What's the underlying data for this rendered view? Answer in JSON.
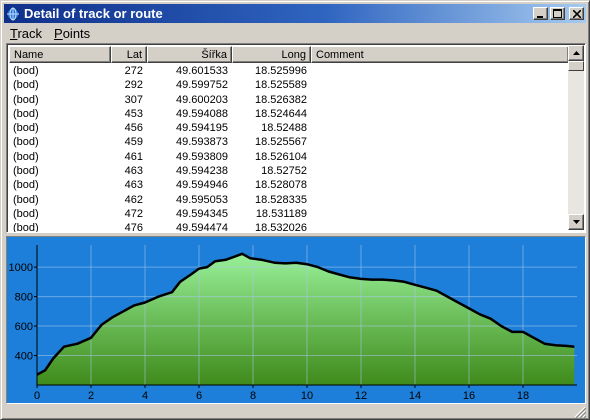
{
  "window": {
    "title": "Detail of track or route"
  },
  "menu": [
    {
      "label": "Track",
      "accel": "T"
    },
    {
      "label": "Points",
      "accel": "P"
    }
  ],
  "table": {
    "columns": [
      "Name",
      "Lat",
      "Šířka",
      "Long",
      "Comment"
    ],
    "rows": [
      [
        "(bod)",
        "272",
        "49.601533",
        "18.525996",
        ""
      ],
      [
        "(bod)",
        "292",
        "49.599752",
        "18.525589",
        ""
      ],
      [
        "(bod)",
        "307",
        "49.600203",
        "18.526382",
        ""
      ],
      [
        "(bod)",
        "453",
        "49.594088",
        "18.524644",
        ""
      ],
      [
        "(bod)",
        "456",
        "49.594195",
        "18.52488",
        ""
      ],
      [
        "(bod)",
        "459",
        "49.593873",
        "18.525567",
        ""
      ],
      [
        "(bod)",
        "461",
        "49.593809",
        "18.526104",
        ""
      ],
      [
        "(bod)",
        "463",
        "49.594238",
        "18.52752",
        ""
      ],
      [
        "(bod)",
        "463",
        "49.594946",
        "18.528078",
        ""
      ],
      [
        "(bod)",
        "462",
        "49.595053",
        "18.528335",
        ""
      ],
      [
        "(bod)",
        "472",
        "49.594345",
        "18.531189",
        ""
      ],
      [
        "(bod)",
        "476",
        "49.594474",
        "18.532026",
        ""
      ]
    ]
  },
  "chart_data": {
    "type": "area",
    "xlim": [
      0,
      20
    ],
    "ylim": [
      200,
      1150
    ],
    "x_ticks": [
      0,
      2,
      4,
      6,
      8,
      10,
      12,
      14,
      16,
      18
    ],
    "y_ticks": [
      400,
      600,
      800,
      1000
    ],
    "grid": true,
    "colors": {
      "background": "#1d7fd9",
      "fill_top": "#98f098",
      "fill_bottom": "#3f8a1a",
      "line": "#000000",
      "grid": "#a8c8f0"
    },
    "x": [
      0,
      0.3,
      0.6,
      1.0,
      1.5,
      2.0,
      2.4,
      2.8,
      3.2,
      3.6,
      4.0,
      4.5,
      5.0,
      5.3,
      5.7,
      6.0,
      6.3,
      6.6,
      7.0,
      7.3,
      7.6,
      7.9,
      8.3,
      8.8,
      9.2,
      9.6,
      10.0,
      10.4,
      10.8,
      11.2,
      11.6,
      12.0,
      12.4,
      12.8,
      13.2,
      13.6,
      14.0,
      14.4,
      14.8,
      15.2,
      15.6,
      16.0,
      16.4,
      16.8,
      17.2,
      17.6,
      18.0,
      18.4,
      18.8,
      19.2,
      19.6,
      19.9
    ],
    "y": [
      270,
      300,
      380,
      460,
      480,
      520,
      610,
      660,
      700,
      740,
      760,
      800,
      830,
      900,
      950,
      990,
      1000,
      1040,
      1050,
      1070,
      1090,
      1060,
      1050,
      1030,
      1025,
      1030,
      1020,
      1000,
      970,
      950,
      930,
      920,
      915,
      915,
      910,
      900,
      880,
      860,
      840,
      800,
      760,
      720,
      680,
      650,
      600,
      560,
      560,
      520,
      480,
      470,
      465,
      460
    ]
  }
}
